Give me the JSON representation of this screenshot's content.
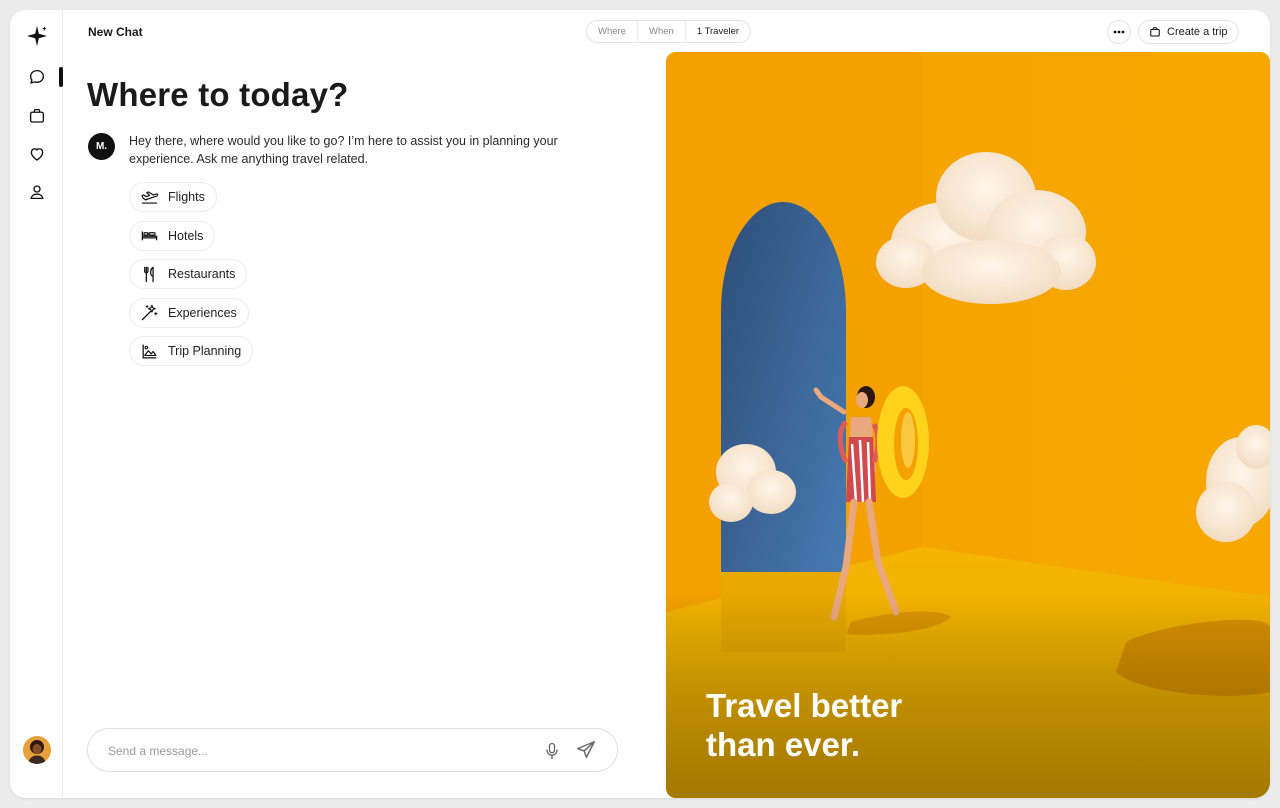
{
  "header": {
    "title": "New Chat",
    "filters": [
      "Where",
      "When",
      "1 Traveler"
    ],
    "create_trip_label": "Create a trip"
  },
  "sidebar": {
    "items": [
      {
        "name": "chat",
        "icon": "chat-bubble-icon",
        "active": true
      },
      {
        "name": "trips",
        "icon": "briefcase-icon",
        "active": false
      },
      {
        "name": "saved",
        "icon": "heart-icon",
        "active": false
      },
      {
        "name": "profile",
        "icon": "user-icon",
        "active": false
      }
    ]
  },
  "main": {
    "heading": "Where to today?",
    "assistant": {
      "avatar_initial": "M.",
      "message": "Hey there, where would you like to go? I’m here to assist you in planning your experience. Ask me anything travel related."
    },
    "suggestions": [
      {
        "label": "Flights",
        "icon": "airplane-icon"
      },
      {
        "label": "Hotels",
        "icon": "bed-icon"
      },
      {
        "label": "Restaurants",
        "icon": "utensils-icon"
      },
      {
        "label": "Experiences",
        "icon": "magic-wand-icon"
      },
      {
        "label": "Trip Planning",
        "icon": "mountain-map-icon"
      }
    ],
    "composer": {
      "placeholder": "Send a message...",
      "value": ""
    }
  },
  "hero": {
    "caption_line1": "Travel better",
    "caption_line2": "than ever."
  },
  "colors": {
    "accent": "#111111",
    "hero_yellow": "#f2a900",
    "hero_shadow_blue": "#3d6fa6"
  }
}
